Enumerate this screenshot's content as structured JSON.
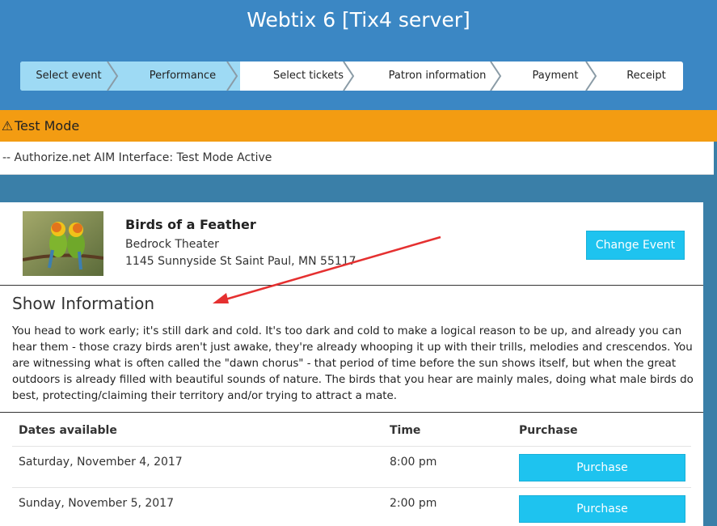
{
  "app": {
    "title": "Webtix 6 [Tix4 server]"
  },
  "steps": [
    {
      "label": "Select event",
      "active": true
    },
    {
      "label": "Performance",
      "active": true
    },
    {
      "label": "Select tickets",
      "active": false
    },
    {
      "label": "Patron information",
      "active": false
    },
    {
      "label": "Payment",
      "active": false
    },
    {
      "label": "Receipt",
      "active": false
    }
  ],
  "alert": {
    "icon": "warning-icon",
    "title": "Test Mode",
    "message": "-- Authorize.net AIM Interface: Test Mode Active"
  },
  "event": {
    "title": "Birds of a Feather",
    "venue": "Bedrock Theater",
    "address": "1145 Sunnyside St Saint Paul, MN 55117",
    "change_label": "Change Event"
  },
  "show": {
    "heading": "Show Information",
    "description": "You head to work early; it's still dark and cold. It's too dark and cold to make a logical reason to be up, and already you can hear them - those crazy birds aren't just awake, they're already whooping it up with their trills, melodies and crescendos. You are witnessing what is often called the \"dawn chorus\" - that period of time before the sun shows itself, but when the great outdoors is already filled with beautiful sounds of nature. The birds that you hear are mainly males, doing what male birds do best, protecting/claiming their territory and/or trying to attract a mate."
  },
  "table": {
    "headers": {
      "date": "Dates available",
      "time": "Time",
      "purchase": "Purchase"
    },
    "rows": [
      {
        "date": "Saturday, November 4, 2017",
        "time": "8:00 pm",
        "button": "Purchase"
      },
      {
        "date": "Sunday, November 5, 2017",
        "time": "2:00 pm",
        "button": "Purchase"
      }
    ]
  },
  "colors": {
    "header_blue": "#3b87c4",
    "active_step": "#9edaf4",
    "alert_orange": "#f39c12",
    "button_cyan": "#1ec3ef",
    "annotation_arrow": "#e53030"
  }
}
